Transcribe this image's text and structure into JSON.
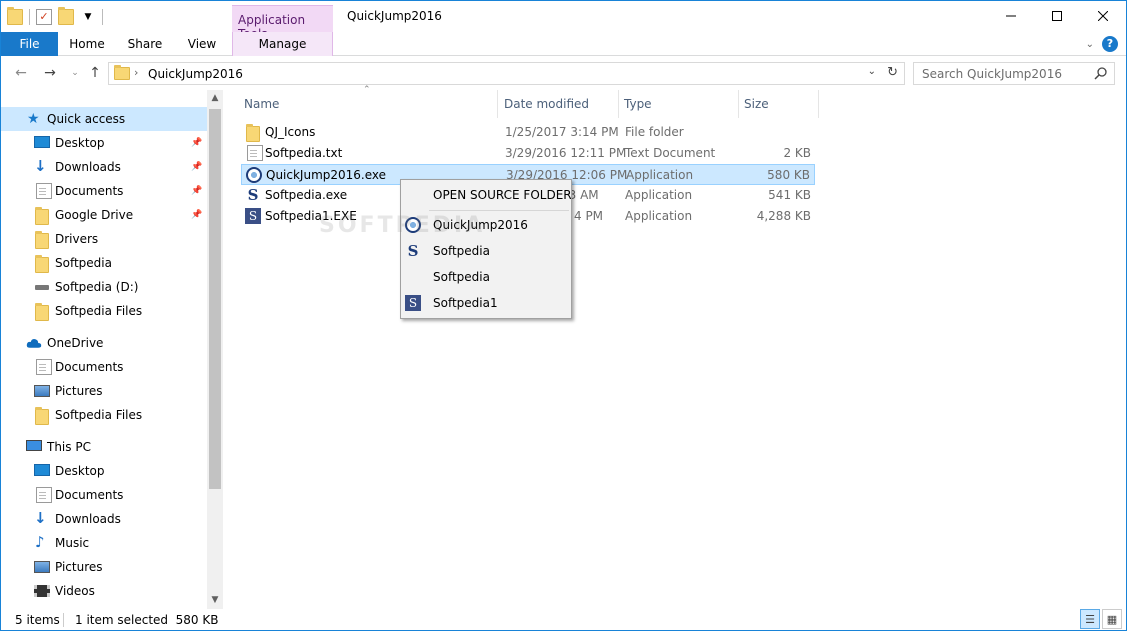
{
  "title_bar": {
    "window_title": "QuickJump2016",
    "contextual_tab_group": "Application Tools",
    "minimize_icon": "minimize-icon",
    "maximize_icon": "maximize-icon",
    "close_icon": "close-icon"
  },
  "ribbon": {
    "tabs": [
      "File",
      "Home",
      "Share",
      "View",
      "Manage"
    ]
  },
  "address_bar": {
    "path": "QuickJump2016",
    "search_placeholder": "Search QuickJump2016"
  },
  "navigation": {
    "items": [
      {
        "label": "Quick access",
        "icon": "star-icon",
        "selected": true,
        "pinned": false
      },
      {
        "label": "Desktop",
        "icon": "desktop-icon",
        "pinned": true
      },
      {
        "label": "Downloads",
        "icon": "downloads-icon",
        "pinned": true
      },
      {
        "label": "Documents",
        "icon": "documents-icon",
        "pinned": true
      },
      {
        "label": "Google Drive",
        "icon": "folder-icon",
        "pinned": true
      },
      {
        "label": "Drivers",
        "icon": "folder-icon",
        "pinned": false
      },
      {
        "label": "Softpedia",
        "icon": "folder-icon",
        "pinned": false
      },
      {
        "label": "Softpedia (D:)",
        "icon": "drive-icon",
        "pinned": false
      },
      {
        "label": "Softpedia Files",
        "icon": "folder-icon",
        "pinned": false
      },
      {
        "label": "OneDrive",
        "icon": "cloud-icon",
        "pinned": false
      },
      {
        "label": "Documents",
        "icon": "documents-icon",
        "pinned": false
      },
      {
        "label": "Pictures",
        "icon": "pictures-icon",
        "pinned": false
      },
      {
        "label": "Softpedia Files",
        "icon": "folder-icon",
        "pinned": false
      },
      {
        "label": "This PC",
        "icon": "computer-icon",
        "pinned": false
      },
      {
        "label": "Desktop",
        "icon": "desktop-icon",
        "pinned": false
      },
      {
        "label": "Documents",
        "icon": "documents-icon",
        "pinned": false
      },
      {
        "label": "Downloads",
        "icon": "downloads-icon",
        "pinned": false
      },
      {
        "label": "Music",
        "icon": "music-icon",
        "pinned": false
      },
      {
        "label": "Pictures",
        "icon": "pictures-icon",
        "pinned": false
      },
      {
        "label": "Videos",
        "icon": "videos-icon",
        "pinned": false
      }
    ]
  },
  "file_list": {
    "columns": [
      "Name",
      "Date modified",
      "Type",
      "Size"
    ],
    "rows": [
      {
        "name": "QJ_Icons",
        "date": "1/25/2017 3:14 PM",
        "type": "File folder",
        "size": "",
        "icon": "folder-icon"
      },
      {
        "name": "Softpedia.txt",
        "date": "3/29/2016 12:11 PM",
        "type": "Text Document",
        "size": "2 KB",
        "icon": "text-file-icon"
      },
      {
        "name": "QuickJump2016.exe",
        "date": "3/29/2016 12:06 PM",
        "type": "Application",
        "size": "580 KB",
        "icon": "quickjump-app-icon",
        "selected": true
      },
      {
        "name": "Softpedia.exe",
        "date": "43 AM",
        "type": "Application",
        "size": "541 KB",
        "icon": "softpedia-s-icon"
      },
      {
        "name": "Softpedia1.EXE",
        "date": "4 PM",
        "type": "Application",
        "size": "4,288 KB",
        "icon": "softpedia-box-icon"
      }
    ]
  },
  "context_menu": {
    "header": "OPEN SOURCE FOLDER",
    "items": [
      {
        "label": "QuickJump2016",
        "icon": "quickjump-app-icon"
      },
      {
        "label": "Softpedia",
        "icon": "softpedia-s-icon"
      },
      {
        "label": "Softpedia",
        "icon": ""
      },
      {
        "label": "Softpedia1",
        "icon": "softpedia-box-icon"
      }
    ]
  },
  "watermark": "SOFTPEDIA",
  "status_bar": {
    "item_count": "5 items",
    "selection": "1 item selected  580 KB"
  },
  "colors": {
    "accent": "#1979ca",
    "selection": "#cce8ff",
    "contextual_tab": "#f2d9f5"
  }
}
